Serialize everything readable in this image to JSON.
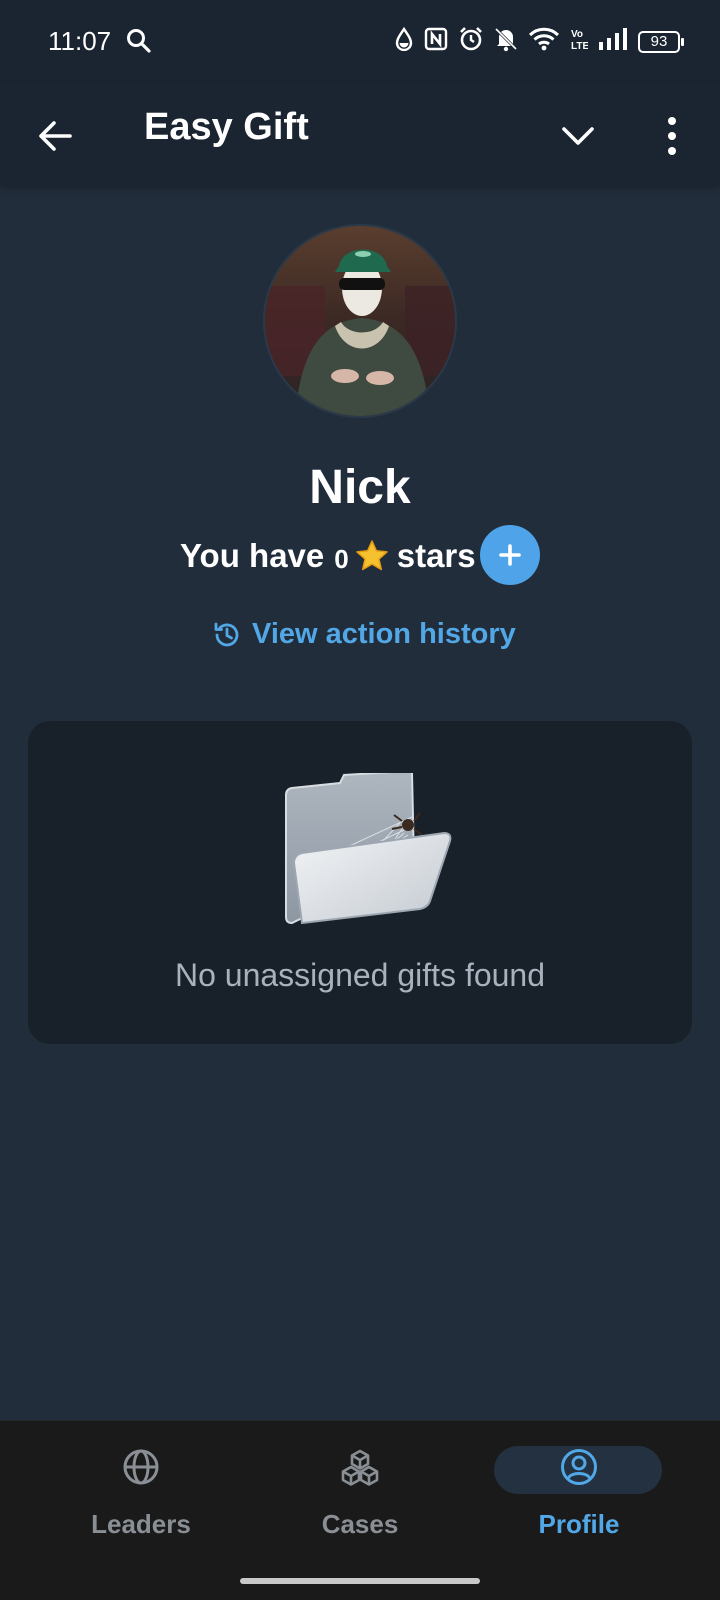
{
  "status_bar": {
    "time": "11:07",
    "battery": "93"
  },
  "app_bar": {
    "title": "Easy Gift"
  },
  "profile": {
    "name": "Nick",
    "stars_prefix": "You have",
    "stars_count": "0",
    "stars_suffix": "stars",
    "history_link": "View action history"
  },
  "gifts": {
    "empty_message": "No unassigned gifts found"
  },
  "bottom_nav": {
    "items": [
      {
        "label": "Leaders",
        "icon": "globe-icon"
      },
      {
        "label": "Cases",
        "icon": "cubes-icon"
      },
      {
        "label": "Profile",
        "icon": "user-circle-icon"
      }
    ],
    "active_index": 2
  },
  "colors": {
    "background": "#212d3b",
    "app_bar": "#1b2531",
    "accent": "#52a8e6",
    "card": "#18202a",
    "nav_bg": "#1a1a1a"
  }
}
